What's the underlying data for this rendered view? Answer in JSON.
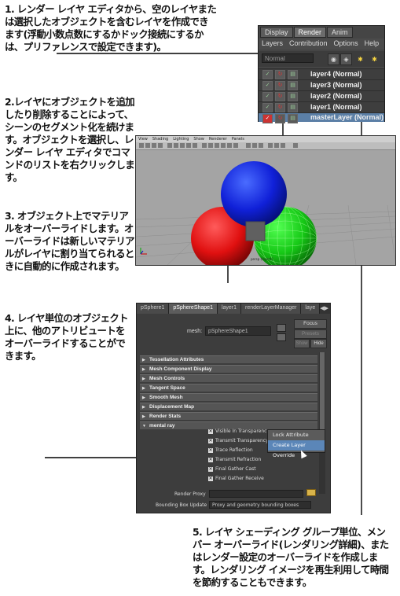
{
  "annotations": {
    "a1": "1. レンダー レイヤ エディタから、空のレイヤまたは選択したオブジェクトを含むレイヤを作成できます(浮動小数点数にするかドック接続にするかは、プリファレンスで設定できます)。",
    "a2": "2.レイヤにオブジェクトを追加したり削除することによって、シーンのセグメント化を続けます。オブジェクトを選択し、レンダー レイヤ エディタでコマンドのリストを右クリックします。",
    "a3": "3. オブジェクト上でマテリアルをオーバーライドします。オーバーライドは新しいマテリアルがレイヤに割り当てられるときに自動的に作成されます。",
    "a4": "4. レイヤ単位のオブジェクト上に、他のアトリビュートをオーバーライドすることができます。",
    "a5": "5. レイヤ シェーディング グループ単位、メンバー オーバーライド(レンダリング詳細)、またはレンダー設定のオーバーライドを作成します。レンダリング イメージを再生利用して時間を節約することもできます。"
  },
  "render_layer_editor": {
    "tabs": [
      "Display",
      "Render",
      "Anim"
    ],
    "menu": [
      "Layers",
      "Contribution",
      "Options",
      "Help"
    ],
    "dropdown_value": "Normal",
    "layers": [
      "layer4 (Normal)",
      "layer3 (Normal)",
      "layer2 (Normal)",
      "layer1 (Normal)",
      "masterLayer (Normal)"
    ]
  },
  "viewport": {
    "menu": [
      "View",
      "Shading",
      "Lighting",
      "Show",
      "Renderer",
      "Panels"
    ],
    "layer_label": "persp (layer4)"
  },
  "attribute_editor": {
    "tabs": [
      "pSphere1",
      "pSphereShape1",
      "layer1",
      "renderLayerManager",
      "laye"
    ],
    "mesh_label": "mesh:",
    "mesh_value": "pSphereShape1",
    "buttons": {
      "focus": "Focus",
      "presets": "Presets",
      "show": "Show",
      "hide": "Hide"
    },
    "sections": [
      "Tessellation Attributes",
      "Mesh Component Display",
      "Mesh Controls",
      "Tangent Space",
      "Smooth Mesh",
      "Displacement Map",
      "Render Stats",
      "mental ray"
    ],
    "checkboxes": [
      "Visible In Transparency",
      "Transmit Transparency",
      "Trace Reflection",
      "Transmit Refraction",
      "Final Gather Cast",
      "Final Gather Receive"
    ],
    "context_menu": [
      "Lock Attribute",
      "Create Layer Override"
    ],
    "render_proxy_label": "Render Proxy",
    "bbox_label": "Bounding Box Update",
    "bbox_value": "Proxy and geometry bounding boxes"
  }
}
